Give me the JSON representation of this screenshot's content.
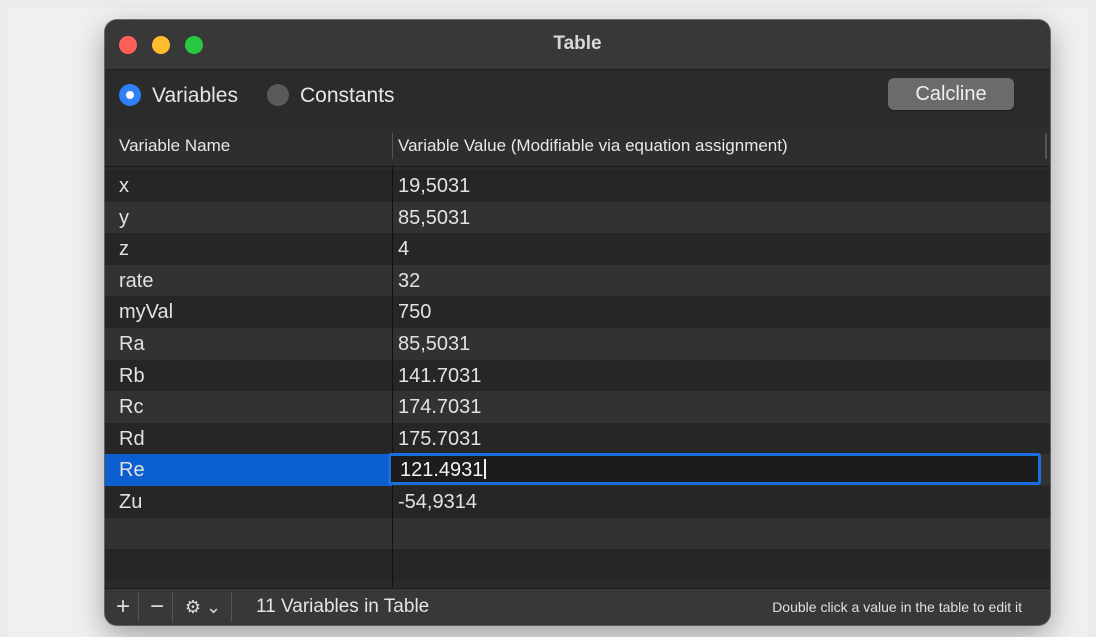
{
  "window": {
    "title": "Table"
  },
  "toolbar": {
    "radio_variables": "Variables",
    "radio_constants": "Constants",
    "selected": "Variables",
    "calc_button": "Calcline"
  },
  "table": {
    "columns": [
      "Variable Name",
      "Variable Value (Modifiable via equation assignment)"
    ],
    "rows": [
      {
        "name": "x",
        "value": "19,5031"
      },
      {
        "name": "y",
        "value": "85,5031"
      },
      {
        "name": "z",
        "value": "4"
      },
      {
        "name": "rate",
        "value": "32"
      },
      {
        "name": "myVal",
        "value": "750"
      },
      {
        "name": "Ra",
        "value": "85,5031"
      },
      {
        "name": "Rb",
        "value": "141.7031"
      },
      {
        "name": "Rc",
        "value": "174.7031"
      },
      {
        "name": "Rd",
        "value": "175.7031"
      },
      {
        "name": "Re",
        "value": "121.4931"
      },
      {
        "name": "Zu",
        "value": "-54,9314"
      }
    ],
    "selected_row_index": 9,
    "editing_value": "121.4931"
  },
  "footer": {
    "add_label": "+",
    "remove_label": "−",
    "gear_label": "⚙︎ ⌄",
    "count_text": "11 Variables in Table",
    "hint_text": "Double click a value in the table to edit it"
  },
  "colors": {
    "accent": "#0b5fd0",
    "close": "#ff5f57",
    "minimize": "#febc2e",
    "zoom": "#28c840"
  }
}
